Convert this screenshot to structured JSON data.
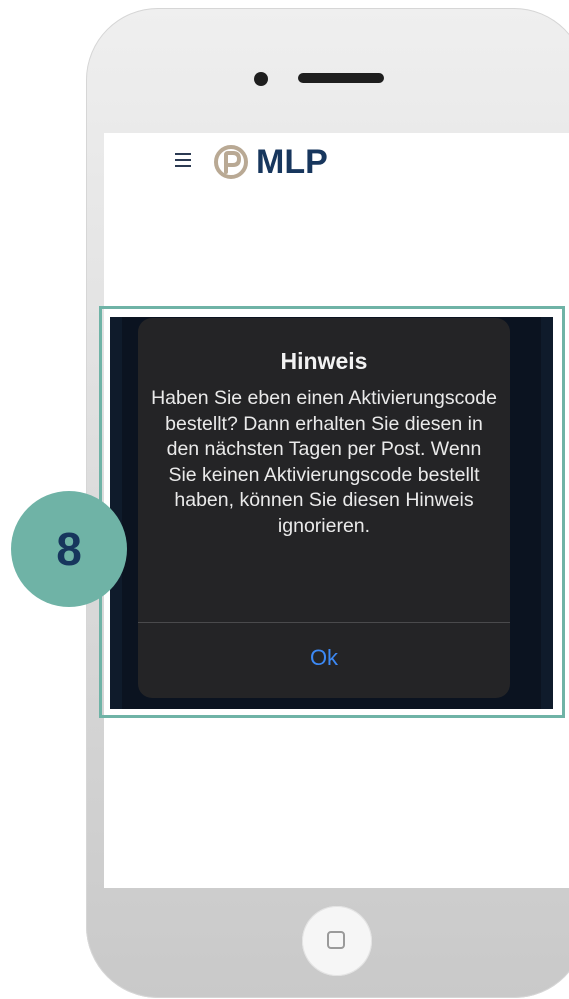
{
  "app": {
    "brand": "MLP",
    "menu_icon": "hamburger-menu-icon",
    "logo_icon": "mlp-logo-icon"
  },
  "dialog": {
    "title": "Hinweis",
    "message": "Haben Sie eben einen Aktivierungscode bestellt? Dann erhalten Sie diesen in den nächsten Tagen per Post. Wenn Sie keinen Aktivierungscode bestellt haben, können Sie diesen Hinweis ignorieren.",
    "ok_label": "Ok"
  },
  "step": {
    "number": "8"
  },
  "colors": {
    "accent": "#6fb3a6",
    "brand": "#17365d",
    "dialog_button": "#3c89f5",
    "dialog_background": "#242426"
  },
  "device": {
    "home_button_icon": "home-button-icon"
  }
}
